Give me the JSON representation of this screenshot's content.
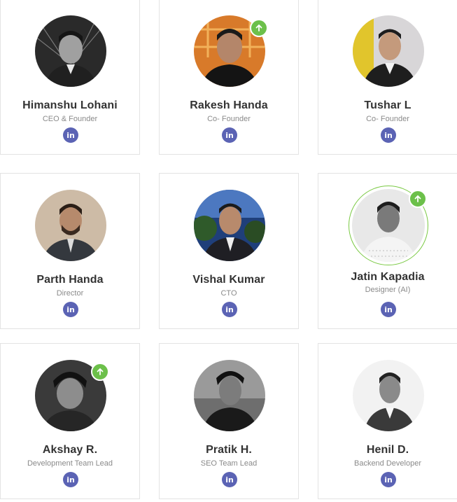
{
  "team": [
    {
      "name": "Himanshu Lohani",
      "role": "CEO & Founder",
      "social": "in"
    },
    {
      "name": "Rakesh Handa",
      "role": "Co- Founder",
      "social": "in"
    },
    {
      "name": "Tushar L",
      "role": "Co- Founder",
      "social": "in"
    },
    {
      "name": "Parth Handa",
      "role": "Director",
      "social": "in"
    },
    {
      "name": "Vishal Kumar",
      "role": "CTO",
      "social": "in"
    },
    {
      "name": "Jatin Kapadia",
      "role": "Designer (AI)",
      "social": "in"
    },
    {
      "name": "Akshay R.",
      "role": "Development Team Lead",
      "social": "in"
    },
    {
      "name": "Pratik H.",
      "role": "SEO Team Lead",
      "social": "in"
    },
    {
      "name": "Henil D.",
      "role": "Backend Developer",
      "social": "in"
    }
  ],
  "colors": {
    "linkedin": "#5b63b4",
    "badge": "#6cc04a",
    "name": "#333333",
    "role": "#8a8a8a"
  },
  "icons": {
    "social": "linkedin-icon",
    "badge": "arrow-up-icon"
  }
}
